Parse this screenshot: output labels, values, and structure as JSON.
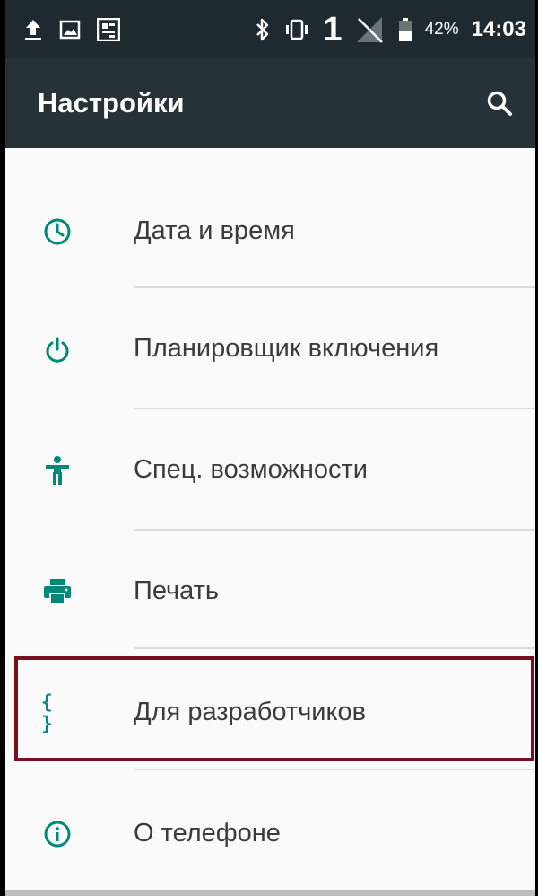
{
  "status_bar": {
    "icons_left": [
      "upload-icon",
      "image-icon",
      "app-notification-icon"
    ],
    "icons_right": [
      "bluetooth-icon",
      "vibrate-icon",
      "sim-icon",
      "no-signal-icon",
      "battery-icon"
    ],
    "sim_number": "1",
    "battery_percent": "42%",
    "time": "14:03"
  },
  "app_bar": {
    "title": "Настройки",
    "search_icon": "search-icon",
    "background": "#263238"
  },
  "accent_color": "#00897b",
  "items": [
    {
      "label": "Дата и время",
      "icon": "clock-icon"
    },
    {
      "label": "Планировщик включения",
      "icon": "power-icon"
    },
    {
      "label": "Спец. возможности",
      "icon": "accessibility-icon"
    },
    {
      "label": "Печать",
      "icon": "print-icon"
    },
    {
      "label": "Для разработчиков",
      "icon": "developer-braces-icon",
      "icon_text": "{ }",
      "highlighted": true
    },
    {
      "label": "О телефоне",
      "icon": "info-icon"
    }
  ],
  "highlight_color": "#7a0f22"
}
